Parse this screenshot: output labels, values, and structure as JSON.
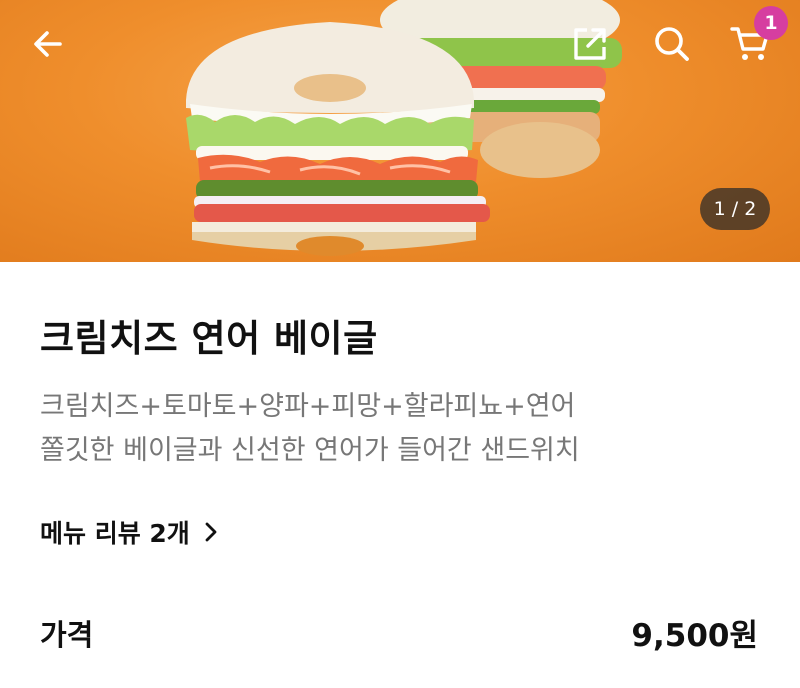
{
  "header": {
    "back_icon": "back-arrow-icon",
    "share_icon": "share-icon",
    "search_icon": "search-icon",
    "cart_icon": "cart-icon",
    "cart_count": "1",
    "badge_color": "#d63ea0"
  },
  "gallery": {
    "pager_text": "1 / 2",
    "background_color": "#ef8e2c"
  },
  "product": {
    "name": "크림치즈 연어 베이글",
    "ingredients": "크림치즈+토마토+양파+피망+할라피뇨+연어",
    "description": "쫄깃한 베이글과 신선한 연어가 들어간 샌드위치"
  },
  "reviews": {
    "label": "메뉴 리뷰 2개",
    "chevron_icon": "chevron-right-icon"
  },
  "price": {
    "label": "가격",
    "value": "9,500원"
  }
}
